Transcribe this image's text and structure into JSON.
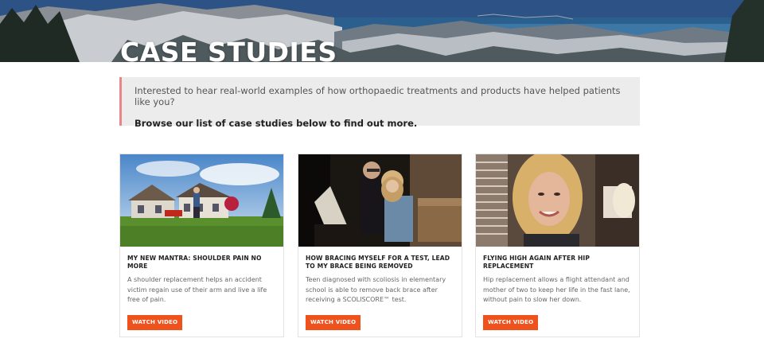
{
  "hero": {
    "title": "CASE STUDIES"
  },
  "intro": {
    "text": "Interested to hear real-world examples of how orthopaedic treatments and products have helped patients like you?",
    "cta": "Browse our list of case studies below to find out more."
  },
  "cards": [
    {
      "title": "MY NEW MANTRA: SHOULDER PAIN NO MORE",
      "description": "A shoulder replacement helps an accident victim regain use of their arm and live a life free of pain.",
      "button": "WATCH VIDEO"
    },
    {
      "title": "HOW BRACING MYSELF FOR A TEST, LEAD TO MY BRACE BEING REMOVED",
      "description": "Teen diagnosed with scoliosis in elementary school is able to remove back brace after receiving a SCOLISCORE™ test.",
      "button": "WATCH VIDEO"
    },
    {
      "title": "FLYING HIGH AGAIN AFTER HIP REPLACEMENT",
      "description": "Hip replacement allows a flight attendant and mother of two to keep her life in the fast lane, without pain to slow her down.",
      "button": "WATCH VIDEO"
    }
  ],
  "colors": {
    "accent": "#f0521e",
    "callout_border": "#e8868a",
    "callout_bg": "#ececec"
  }
}
